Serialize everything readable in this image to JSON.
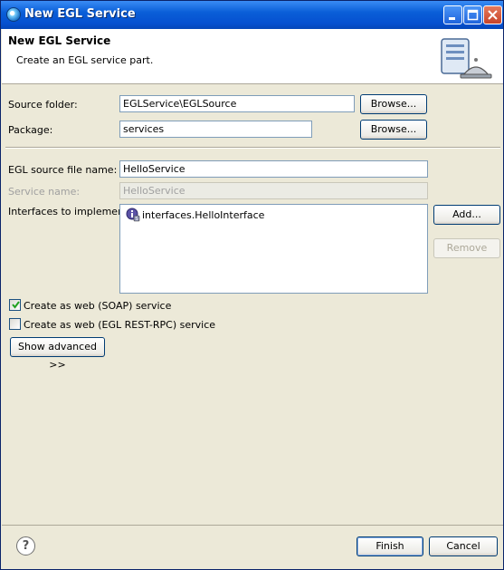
{
  "window": {
    "title": "New EGL Service"
  },
  "header": {
    "title": "New EGL Service",
    "description": "Create an EGL service part."
  },
  "form": {
    "source_folder": {
      "label": "Source folder:",
      "value": "EGLService\\EGLSource",
      "browse_label": "Browse..."
    },
    "package": {
      "label": "Package:",
      "value": "services",
      "browse_label": "Browse..."
    },
    "source_file_name": {
      "label": "EGL source file name:",
      "value": "HelloService"
    },
    "service_name": {
      "label": "Service name:",
      "value": "HelloService"
    },
    "interfaces": {
      "label": "Interfaces to implement:",
      "items": [
        "interfaces.HelloInterface"
      ],
      "add_label": "Add...",
      "remove_label": "Remove"
    },
    "soap": {
      "label": "Create as web (SOAP) service",
      "checked": true
    },
    "rest": {
      "label": "Create as web (EGL REST-RPC) service",
      "checked": false
    },
    "advanced_label": "Show advanced >>"
  },
  "footer": {
    "finish_label": "Finish",
    "cancel_label": "Cancel",
    "help_glyph": "?"
  }
}
